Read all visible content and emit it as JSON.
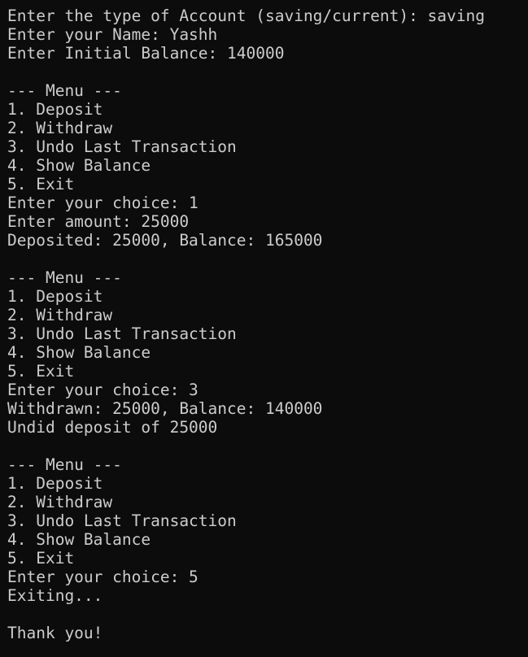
{
  "terminal": {
    "lines": [
      "Enter the type of Account (saving/current): saving",
      "Enter your Name: Yashh",
      "Enter Initial Balance: 140000",
      "",
      "--- Menu ---",
      "1. Deposit",
      "2. Withdraw",
      "3. Undo Last Transaction",
      "4. Show Balance",
      "5. Exit",
      "Enter your choice: 1",
      "Enter amount: 25000",
      "Deposited: 25000, Balance: 165000",
      "",
      "--- Menu ---",
      "1. Deposit",
      "2. Withdraw",
      "3. Undo Last Transaction",
      "4. Show Balance",
      "5. Exit",
      "Enter your choice: 3",
      "Withdrawn: 25000, Balance: 140000",
      "Undid deposit of 25000",
      "",
      "--- Menu ---",
      "1. Deposit",
      "2. Withdraw",
      "3. Undo Last Transaction",
      "4. Show Balance",
      "5. Exit",
      "Enter your choice: 5",
      "Exiting...",
      "",
      "Thank you!"
    ]
  }
}
